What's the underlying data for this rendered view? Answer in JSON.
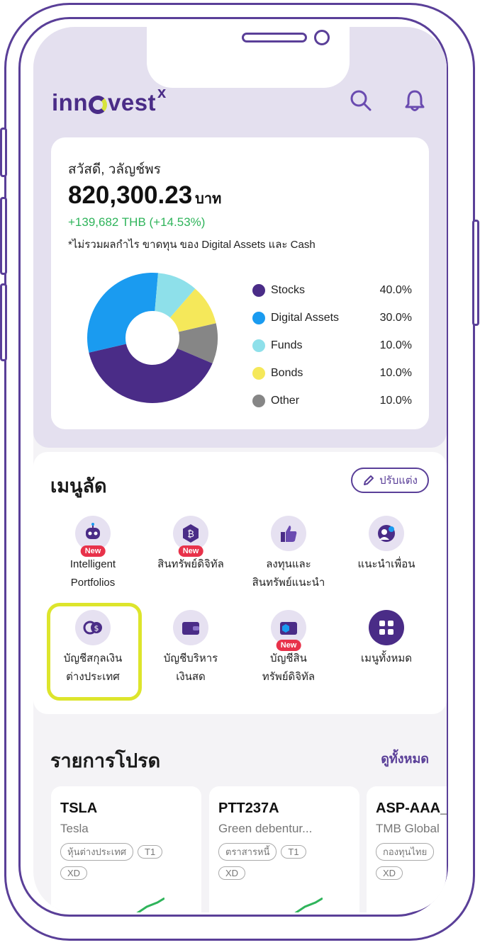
{
  "app": {
    "logo_text_pre": "inn",
    "logo_text_post": "vest",
    "logo_sup": "x",
    "brand_color": "#4a2c87",
    "accent_color": "#dde52c"
  },
  "header": {
    "search_icon": "search-icon",
    "bell_icon": "bell-icon"
  },
  "portfolio": {
    "greeting": "สวัสดี, วลัญช์พร",
    "total_value": "820,300.23",
    "currency": "บาท",
    "change": "+139,682 THB (+14.53%)",
    "note": "*ไม่รวมผลกำไร ขาดทุน ของ Digital Assets และ Cash"
  },
  "chart_data": {
    "type": "pie",
    "donut": true,
    "categories": [
      "Stocks",
      "Digital Assets",
      "Funds",
      "Bonds",
      "Other"
    ],
    "values": [
      40.0,
      30.0,
      10.0,
      10.0,
      10.0
    ],
    "labels": [
      "40.0%",
      "30.0%",
      "10.0%",
      "10.0%",
      "10.0%"
    ],
    "colors": [
      "#4a2c87",
      "#1a9bf0",
      "#8ee0ea",
      "#f5e85a",
      "#868686"
    ],
    "legend_position": "right"
  },
  "shortcuts": {
    "title": "เมนูลัด",
    "edit_label": "ปรับแต่ง",
    "new_badge": "New",
    "items": [
      {
        "line1": "Intelligent",
        "line2": "Portfolios",
        "is_new": true
      },
      {
        "line1": "สินทรัพย์ดิจิทัล",
        "line2": "",
        "is_new": true
      },
      {
        "line1": "ลงทุนและ",
        "line2": "สินทรัพย์แนะนำ",
        "is_new": false
      },
      {
        "line1": "แนะนำเพื่อน",
        "line2": "",
        "is_new": false
      },
      {
        "line1": "บัญชีสกุลเงิน",
        "line2": "ต่างประเทศ",
        "is_new": false
      },
      {
        "line1": "บัญชีบริหาร",
        "line2": "เงินสด",
        "is_new": false
      },
      {
        "line1": "บัญชีสิน",
        "line2": "ทรัพย์ดิจิทัล",
        "is_new": true
      },
      {
        "line1": "เมนูทั้งหมด",
        "line2": "",
        "is_new": false
      }
    ]
  },
  "favorites": {
    "title": "รายการโปรด",
    "see_all": "ดูทั้งหมด",
    "items": [
      {
        "symbol": "TSLA",
        "name": "Tesla",
        "tags": [
          "หุ้นต่างประเทศ",
          "T1"
        ],
        "tags2": [
          "XD"
        ]
      },
      {
        "symbol": "PTT237A",
        "name": "Green debentur...",
        "tags": [
          "ตราสารหนี้",
          "T1"
        ],
        "tags2": [
          "XD"
        ]
      },
      {
        "symbol": "ASP-AAA_",
        "name": "TMB Global",
        "tags": [
          "กองทุนไทย"
        ],
        "tags2": [
          "XD"
        ]
      }
    ]
  }
}
